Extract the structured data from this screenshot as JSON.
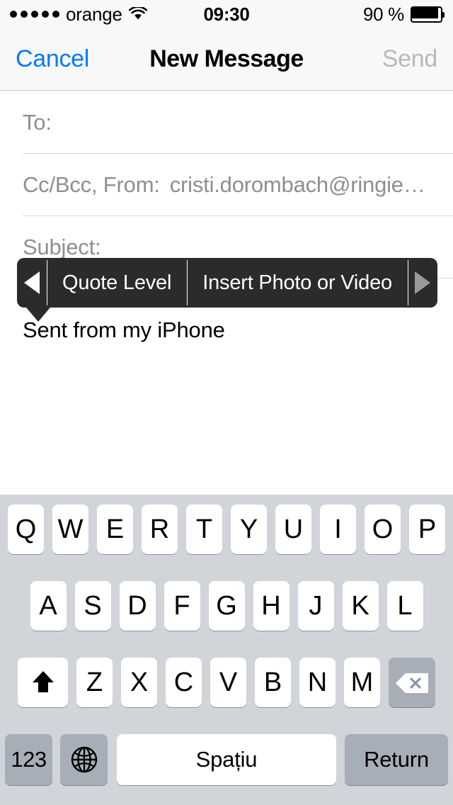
{
  "status_bar": {
    "signal_dots": 5,
    "carrier": "orange",
    "wifi_icon": "wifi-icon",
    "time": "09:30",
    "battery_percent": "90 %",
    "battery_level": 90
  },
  "nav_bar": {
    "cancel_label": "Cancel",
    "title": "New Message",
    "send_label": "Send",
    "cancel_color": "#007aff",
    "send_color": "#b8b8bd"
  },
  "compose": {
    "to_label": "To:",
    "to_value": "",
    "ccbcc_label": "Cc/Bcc, From:",
    "ccbcc_value": "cristi.dorombach@ringie…",
    "subject_label": "Subject:",
    "subject_value": "",
    "body_text": "Sent from my iPhone"
  },
  "edit_menu": {
    "prev_arrow_icon": "triangle-left-icon",
    "next_arrow_icon": "triangle-right-icon",
    "items": [
      {
        "label": "Quote Level"
      },
      {
        "label": "Insert Photo or Video"
      }
    ],
    "background_color": "#2b2b2b",
    "prev_arrow_color": "#ffffff",
    "next_arrow_color": "#9a9a9a"
  },
  "keyboard": {
    "language": "Romanian",
    "background_color": "#d1d4d9",
    "row1": [
      "Q",
      "W",
      "E",
      "R",
      "T",
      "Y",
      "U",
      "I",
      "O",
      "P"
    ],
    "row2": [
      "A",
      "S",
      "D",
      "F",
      "G",
      "H",
      "J",
      "K",
      "L"
    ],
    "row3_letters": [
      "Z",
      "X",
      "C",
      "V",
      "B",
      "N",
      "M"
    ],
    "shift_icon": "shift-arrow-icon",
    "delete_icon": "backspace-icon",
    "numbers_label": "123",
    "globe_icon": "globe-icon",
    "space_label": "Spațiu",
    "return_label": "Return"
  }
}
